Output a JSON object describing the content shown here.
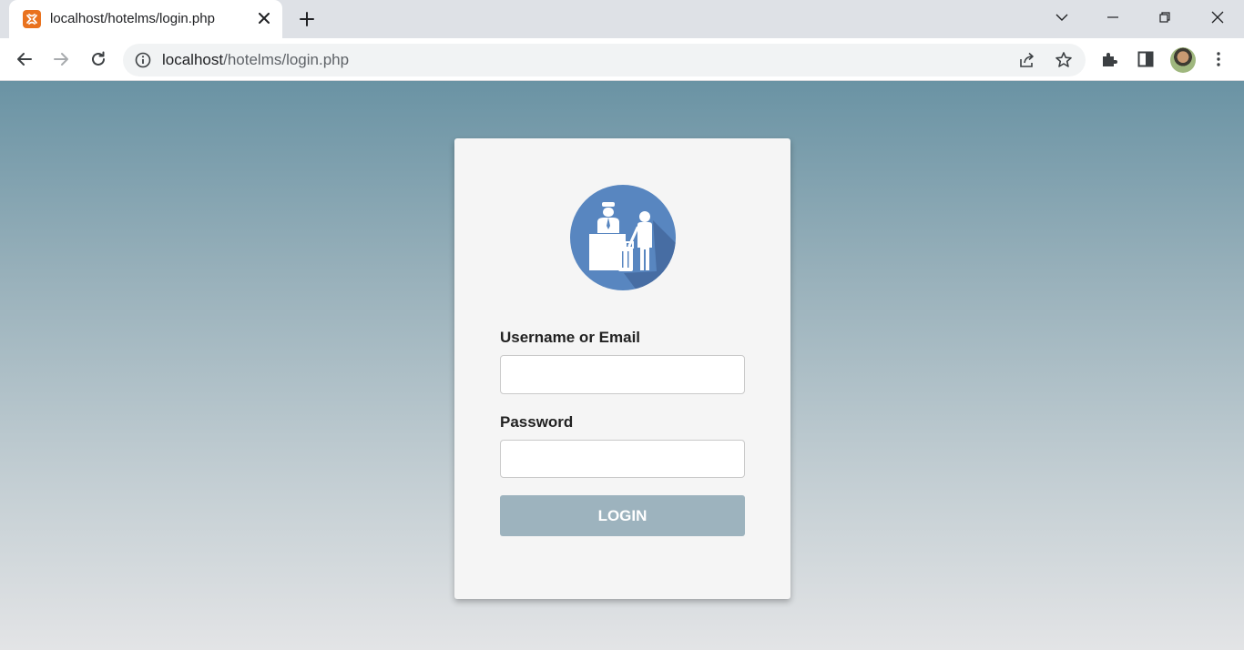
{
  "browser": {
    "tab": {
      "title": "localhost/hotelms/login.php",
      "favicon": "xampp-icon"
    },
    "address_bar": {
      "host": "localhost",
      "path": "/hotelms/login.php"
    },
    "icons": [
      "back-arrow-icon",
      "forward-arrow-icon",
      "reload-icon",
      "info-icon",
      "share-icon",
      "star-icon",
      "extensions-puzzle-icon",
      "side-panel-icon",
      "profile-avatar",
      "kebab-menu-icon",
      "tab-search-chevron-icon",
      "minimize-icon",
      "restore-icon",
      "close-icon"
    ]
  },
  "login_form": {
    "logo": "hotel-reception-icon",
    "username_label": "Username or Email",
    "username_value": "",
    "password_label": "Password",
    "password_value": "",
    "submit_label": "LOGIN"
  },
  "colors": {
    "logo_circle": "#5886c0",
    "button": "#9db3be",
    "background_top": "#6a93a4",
    "background_bottom": "#e3e4e6",
    "xampp_orange": "#e9721e"
  }
}
